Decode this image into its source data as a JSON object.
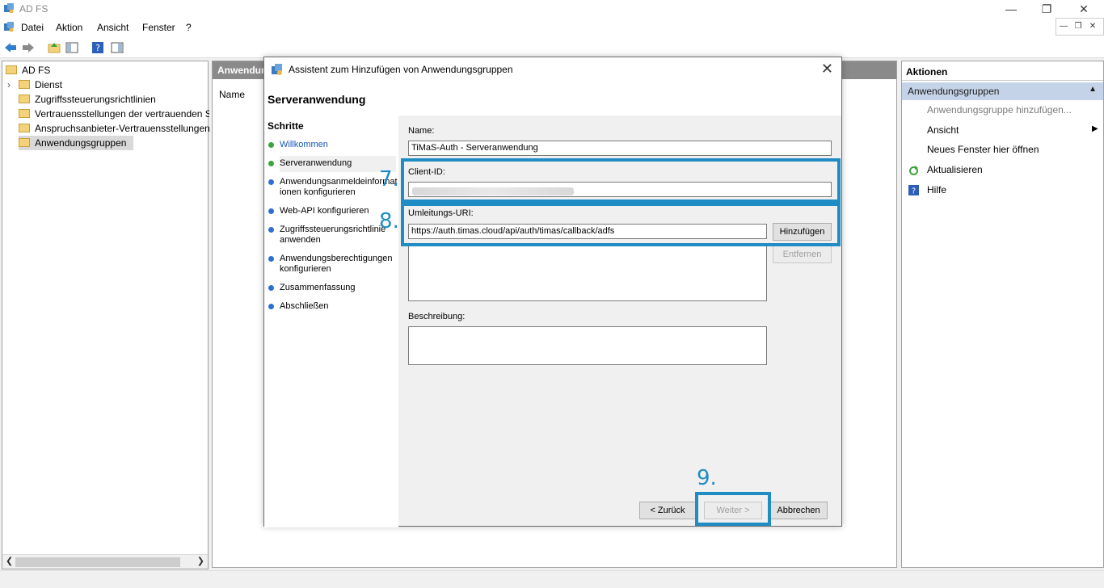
{
  "window": {
    "title": "AD FS"
  },
  "menu": {
    "items": [
      "Datei",
      "Aktion",
      "Ansicht",
      "Fenster",
      "?"
    ]
  },
  "tree": {
    "items": [
      {
        "label": "AD FS"
      },
      {
        "label": "Dienst"
      },
      {
        "label": "Zugriffssteuerungsrichtlinien"
      },
      {
        "label": "Vertrauensstellungen der vertrauenden S"
      },
      {
        "label": "Anspruchsanbieter-Vertrauensstellungen"
      },
      {
        "label": "Anwendungsgruppen"
      }
    ]
  },
  "middle": {
    "header": "Anwendun",
    "column": "Name"
  },
  "actions": {
    "header": "Aktionen",
    "section": "Anwendungsgruppen",
    "items": [
      "Anwendungsgruppe hinzufügen...",
      "Ansicht",
      "Neues Fenster hier öffnen",
      "Aktualisieren",
      "Hilfe"
    ]
  },
  "dialog": {
    "title": "Assistent zum Hinzufügen von Anwendungsgruppen",
    "heading": "Serveranwendung",
    "steps_header": "Schritte",
    "steps": [
      "Willkommen",
      "Serveranwendung",
      "Anwendungsanmeldeinformationen konfigurieren",
      "Web-API konfigurieren",
      "Zugriffssteuerungsrichtlinie anwenden",
      "Anwendungsberechtigungen konfigurieren",
      "Zusammenfassung",
      "Abschließen"
    ],
    "steps_display": [
      [
        "Willkommen"
      ],
      [
        "Serveranwendung"
      ],
      [
        "Anwendungsanmeldeinformat",
        "ionen konfigurieren"
      ],
      [
        "Web-API konfigurieren"
      ],
      [
        "Zugriffssteuerungsrichtlinie",
        "anwenden"
      ],
      [
        "Anwendungsberechtigungen",
        "konfigurieren"
      ],
      [
        "Zusammenfassung"
      ],
      [
        "Abschließen"
      ]
    ],
    "name_label": "Name:",
    "name_value": "TiMaS-Auth - Serveranwendung",
    "client_id_label": "Client-ID:",
    "redirect_label": "Umleitungs-URI:",
    "redirect_value": "https://auth.timas.cloud/api/auth/timas/callback/adfs",
    "add_button": "Hinzufügen",
    "remove_button": "Entfernen",
    "description_label": "Beschreibung:",
    "back_button": "< Zurück",
    "next_button": "Weiter >",
    "cancel_button": "Abbrechen"
  },
  "annotations": {
    "step7": "7.",
    "step8": "8.",
    "step9": "9."
  },
  "colors": {
    "highlight": "#1f8cc4",
    "step_done": "#3aa53a",
    "step_pending": "#2f6fd0"
  }
}
